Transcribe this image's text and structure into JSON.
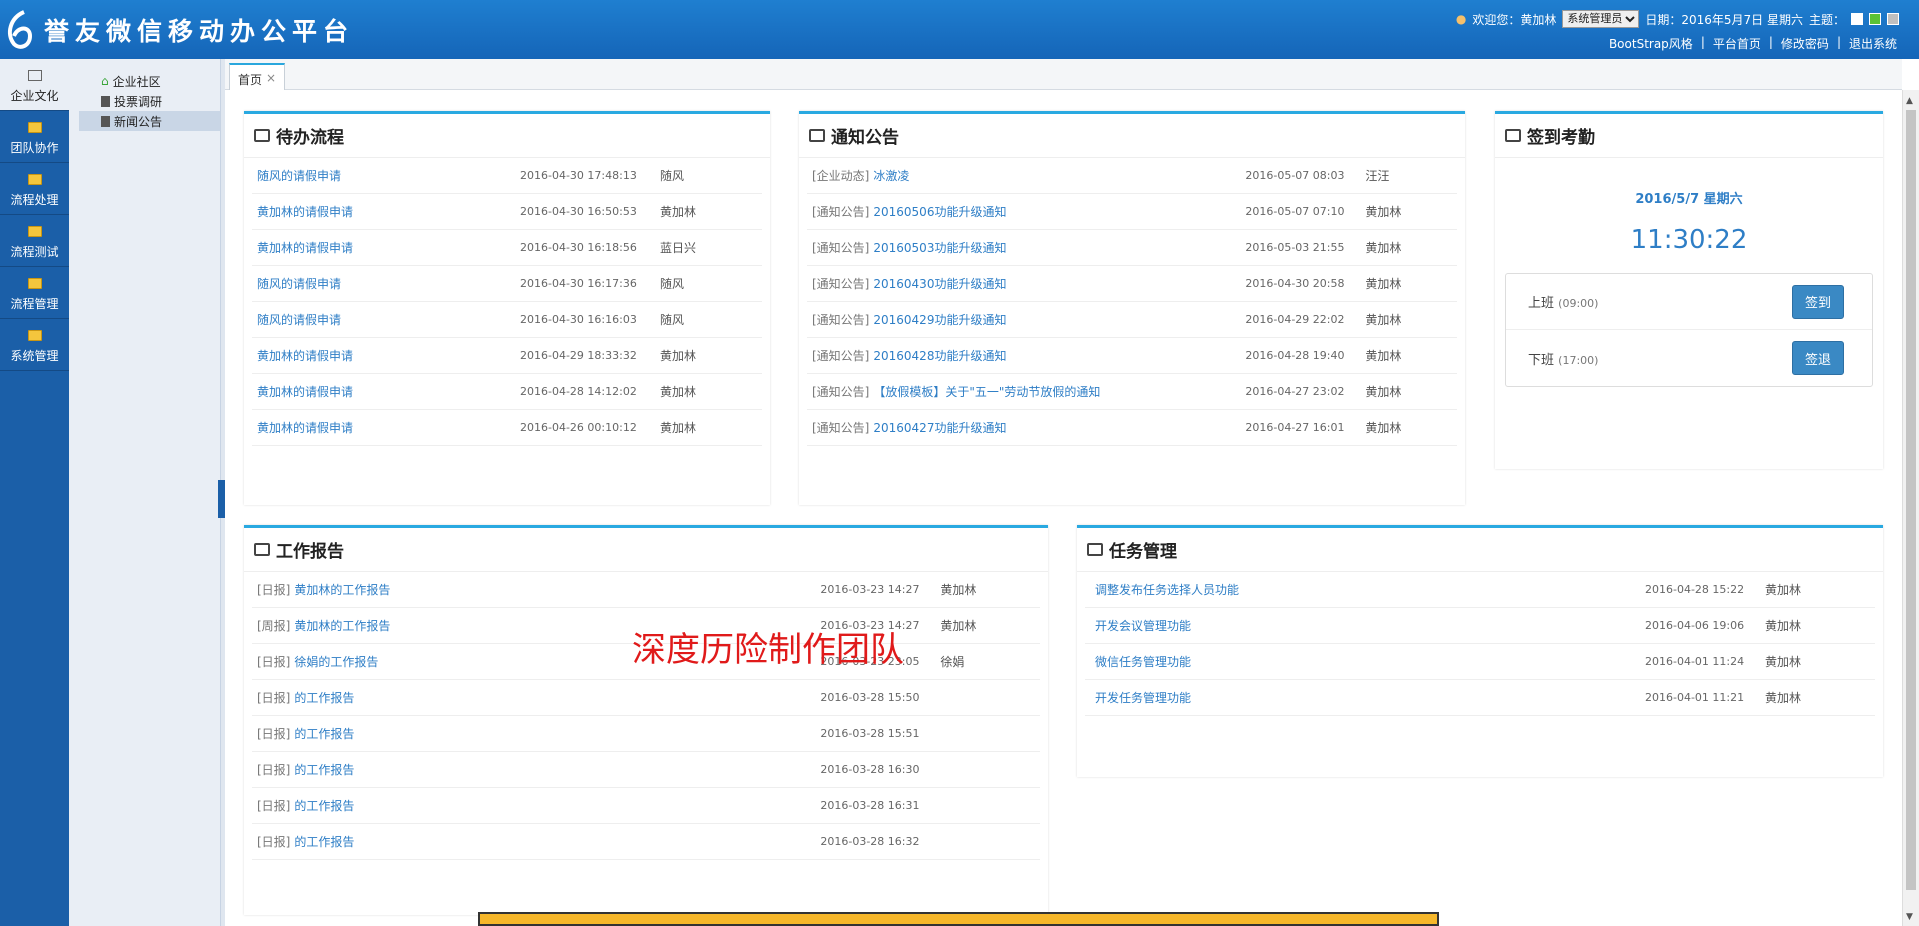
{
  "header": {
    "brand": "誉友微信移动办公平台",
    "welcome": "欢迎您：黄加林",
    "role": "系统管理员",
    "date": "日期：2016年5月7日 星期六",
    "theme_label": "主题：",
    "links": [
      "BootStrap风格",
      "平台首页",
      "修改密码",
      "退出系统"
    ],
    "theme_colors": [
      "#ffffff",
      "#5bc236",
      "#bfbfbf"
    ]
  },
  "leftnav": [
    "企业文化",
    "团队协作",
    "流程处理",
    "流程测试",
    "流程管理",
    "系统管理"
  ],
  "subnav": [
    "企业社区",
    "投票调研",
    "新闻公告"
  ],
  "tab": {
    "label": "首页",
    "close": "×"
  },
  "todo": {
    "title": "待办流程",
    "rows": [
      {
        "t": "随风的请假申请",
        "d": "2016-04-30 17:48:13",
        "u": "随风"
      },
      {
        "t": "黄加林的请假申请",
        "d": "2016-04-30 16:50:53",
        "u": "黄加林"
      },
      {
        "t": "黄加林的请假申请",
        "d": "2016-04-30 16:18:56",
        "u": "蓝日兴"
      },
      {
        "t": "随风的请假申请",
        "d": "2016-04-30 16:17:36",
        "u": "随风"
      },
      {
        "t": "随风的请假申请",
        "d": "2016-04-30 16:16:03",
        "u": "随风"
      },
      {
        "t": "黄加林的请假申请",
        "d": "2016-04-29 18:33:32",
        "u": "黄加林"
      },
      {
        "t": "黄加林的请假申请",
        "d": "2016-04-28 14:12:02",
        "u": "黄加林"
      },
      {
        "t": "黄加林的请假申请",
        "d": "2016-04-26 00:10:12",
        "u": "黄加林"
      }
    ]
  },
  "notice": {
    "title": "通知公告",
    "rows": [
      {
        "c": "[企业动态]",
        "t": "冰激凌",
        "d": "2016-05-07 08:03",
        "u": "汪汪"
      },
      {
        "c": "[通知公告]",
        "t": "20160506功能升级通知",
        "d": "2016-05-07 07:10",
        "u": "黄加林"
      },
      {
        "c": "[通知公告]",
        "t": "20160503功能升级通知",
        "d": "2016-05-03 21:55",
        "u": "黄加林"
      },
      {
        "c": "[通知公告]",
        "t": "20160430功能升级通知",
        "d": "2016-04-30 20:58",
        "u": "黄加林"
      },
      {
        "c": "[通知公告]",
        "t": "20160429功能升级通知",
        "d": "2016-04-29 22:02",
        "u": "黄加林"
      },
      {
        "c": "[通知公告]",
        "t": "20160428功能升级通知",
        "d": "2016-04-28 19:40",
        "u": "黄加林"
      },
      {
        "c": "[通知公告]",
        "t": "【放假模板】关于\"五一\"劳动节放假的通知",
        "d": "2016-04-27 23:02",
        "u": "黄加林"
      },
      {
        "c": "[通知公告]",
        "t": "20160427功能升级通知",
        "d": "2016-04-27 16:01",
        "u": "黄加林"
      }
    ]
  },
  "punch": {
    "title": "签到考勤",
    "date": "2016/5/7 星期六",
    "time": "11:30:22",
    "on_label": "上班",
    "on_time": "(09:00)",
    "on_btn": "签到",
    "off_label": "下班",
    "off_time": "(17:00)",
    "off_btn": "签退"
  },
  "report": {
    "title": "工作报告",
    "rows": [
      {
        "c": "[日报]",
        "t": "黄加林的工作报告",
        "d": "2016-03-23 14:27",
        "u": "黄加林"
      },
      {
        "c": "[周报]",
        "t": "黄加林的工作报告",
        "d": "2016-03-23 14:27",
        "u": "黄加林"
      },
      {
        "c": "[日报]",
        "t": "徐娟的工作报告",
        "d": "2016-03-23 23:05",
        "u": "徐娟"
      },
      {
        "c": "[日报]",
        "t": "的工作报告",
        "d": "2016-03-28 15:50",
        "u": ""
      },
      {
        "c": "[日报]",
        "t": "的工作报告",
        "d": "2016-03-28 15:51",
        "u": ""
      },
      {
        "c": "[日报]",
        "t": "的工作报告",
        "d": "2016-03-28 16:30",
        "u": ""
      },
      {
        "c": "[日报]",
        "t": "的工作报告",
        "d": "2016-03-28 16:31",
        "u": ""
      },
      {
        "c": "[日报]",
        "t": "的工作报告",
        "d": "2016-03-28 16:32",
        "u": ""
      }
    ]
  },
  "task": {
    "title": "任务管理",
    "rows": [
      {
        "t": "调整发布任务选择人员功能",
        "d": "2016-04-28 15:22",
        "u": "黄加林"
      },
      {
        "t": "开发会议管理功能",
        "d": "2016-04-06 19:06",
        "u": "黄加林"
      },
      {
        "t": "微信任务管理功能",
        "d": "2016-04-01 11:24",
        "u": "黄加林"
      },
      {
        "t": "开发任务管理功能",
        "d": "2016-04-01 11:21",
        "u": "黄加林"
      }
    ]
  },
  "watermark": "深度历险制作团队"
}
